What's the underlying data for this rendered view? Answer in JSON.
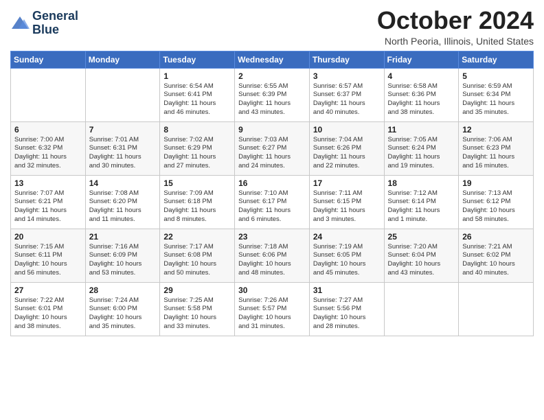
{
  "logo": {
    "line1": "General",
    "line2": "Blue"
  },
  "title": "October 2024",
  "location": "North Peoria, Illinois, United States",
  "weekdays": [
    "Sunday",
    "Monday",
    "Tuesday",
    "Wednesday",
    "Thursday",
    "Friday",
    "Saturday"
  ],
  "weeks": [
    [
      {
        "day": "",
        "content": ""
      },
      {
        "day": "",
        "content": ""
      },
      {
        "day": "1",
        "content": "Sunrise: 6:54 AM\nSunset: 6:41 PM\nDaylight: 11 hours\nand 46 minutes."
      },
      {
        "day": "2",
        "content": "Sunrise: 6:55 AM\nSunset: 6:39 PM\nDaylight: 11 hours\nand 43 minutes."
      },
      {
        "day": "3",
        "content": "Sunrise: 6:57 AM\nSunset: 6:37 PM\nDaylight: 11 hours\nand 40 minutes."
      },
      {
        "day": "4",
        "content": "Sunrise: 6:58 AM\nSunset: 6:36 PM\nDaylight: 11 hours\nand 38 minutes."
      },
      {
        "day": "5",
        "content": "Sunrise: 6:59 AM\nSunset: 6:34 PM\nDaylight: 11 hours\nand 35 minutes."
      }
    ],
    [
      {
        "day": "6",
        "content": "Sunrise: 7:00 AM\nSunset: 6:32 PM\nDaylight: 11 hours\nand 32 minutes."
      },
      {
        "day": "7",
        "content": "Sunrise: 7:01 AM\nSunset: 6:31 PM\nDaylight: 11 hours\nand 30 minutes."
      },
      {
        "day": "8",
        "content": "Sunrise: 7:02 AM\nSunset: 6:29 PM\nDaylight: 11 hours\nand 27 minutes."
      },
      {
        "day": "9",
        "content": "Sunrise: 7:03 AM\nSunset: 6:27 PM\nDaylight: 11 hours\nand 24 minutes."
      },
      {
        "day": "10",
        "content": "Sunrise: 7:04 AM\nSunset: 6:26 PM\nDaylight: 11 hours\nand 22 minutes."
      },
      {
        "day": "11",
        "content": "Sunrise: 7:05 AM\nSunset: 6:24 PM\nDaylight: 11 hours\nand 19 minutes."
      },
      {
        "day": "12",
        "content": "Sunrise: 7:06 AM\nSunset: 6:23 PM\nDaylight: 11 hours\nand 16 minutes."
      }
    ],
    [
      {
        "day": "13",
        "content": "Sunrise: 7:07 AM\nSunset: 6:21 PM\nDaylight: 11 hours\nand 14 minutes."
      },
      {
        "day": "14",
        "content": "Sunrise: 7:08 AM\nSunset: 6:20 PM\nDaylight: 11 hours\nand 11 minutes."
      },
      {
        "day": "15",
        "content": "Sunrise: 7:09 AM\nSunset: 6:18 PM\nDaylight: 11 hours\nand 8 minutes."
      },
      {
        "day": "16",
        "content": "Sunrise: 7:10 AM\nSunset: 6:17 PM\nDaylight: 11 hours\nand 6 minutes."
      },
      {
        "day": "17",
        "content": "Sunrise: 7:11 AM\nSunset: 6:15 PM\nDaylight: 11 hours\nand 3 minutes."
      },
      {
        "day": "18",
        "content": "Sunrise: 7:12 AM\nSunset: 6:14 PM\nDaylight: 11 hours\nand 1 minute."
      },
      {
        "day": "19",
        "content": "Sunrise: 7:13 AM\nSunset: 6:12 PM\nDaylight: 10 hours\nand 58 minutes."
      }
    ],
    [
      {
        "day": "20",
        "content": "Sunrise: 7:15 AM\nSunset: 6:11 PM\nDaylight: 10 hours\nand 56 minutes."
      },
      {
        "day": "21",
        "content": "Sunrise: 7:16 AM\nSunset: 6:09 PM\nDaylight: 10 hours\nand 53 minutes."
      },
      {
        "day": "22",
        "content": "Sunrise: 7:17 AM\nSunset: 6:08 PM\nDaylight: 10 hours\nand 50 minutes."
      },
      {
        "day": "23",
        "content": "Sunrise: 7:18 AM\nSunset: 6:06 PM\nDaylight: 10 hours\nand 48 minutes."
      },
      {
        "day": "24",
        "content": "Sunrise: 7:19 AM\nSunset: 6:05 PM\nDaylight: 10 hours\nand 45 minutes."
      },
      {
        "day": "25",
        "content": "Sunrise: 7:20 AM\nSunset: 6:04 PM\nDaylight: 10 hours\nand 43 minutes."
      },
      {
        "day": "26",
        "content": "Sunrise: 7:21 AM\nSunset: 6:02 PM\nDaylight: 10 hours\nand 40 minutes."
      }
    ],
    [
      {
        "day": "27",
        "content": "Sunrise: 7:22 AM\nSunset: 6:01 PM\nDaylight: 10 hours\nand 38 minutes."
      },
      {
        "day": "28",
        "content": "Sunrise: 7:24 AM\nSunset: 6:00 PM\nDaylight: 10 hours\nand 35 minutes."
      },
      {
        "day": "29",
        "content": "Sunrise: 7:25 AM\nSunset: 5:58 PM\nDaylight: 10 hours\nand 33 minutes."
      },
      {
        "day": "30",
        "content": "Sunrise: 7:26 AM\nSunset: 5:57 PM\nDaylight: 10 hours\nand 31 minutes."
      },
      {
        "day": "31",
        "content": "Sunrise: 7:27 AM\nSunset: 5:56 PM\nDaylight: 10 hours\nand 28 minutes."
      },
      {
        "day": "",
        "content": ""
      },
      {
        "day": "",
        "content": ""
      }
    ]
  ]
}
